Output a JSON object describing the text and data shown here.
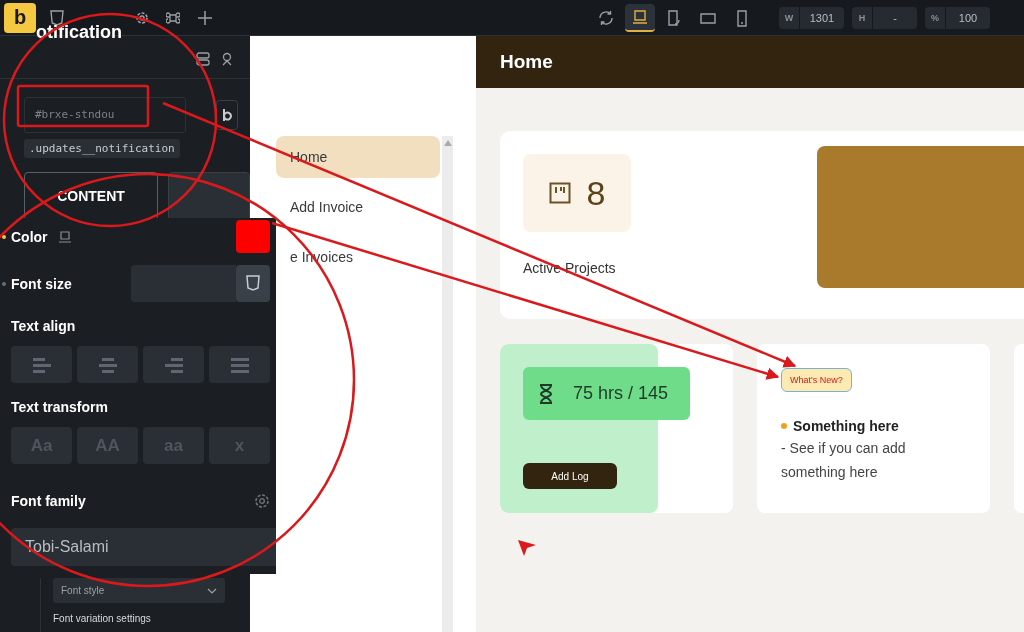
{
  "toolbar": {
    "logo": "b",
    "devices": [
      {
        "kind": "refresh",
        "selected": false
      },
      {
        "kind": "laptop",
        "selected": true
      },
      {
        "kind": "tablet",
        "selected": false
      },
      {
        "kind": "landscape",
        "selected": false
      },
      {
        "kind": "phone",
        "selected": false
      }
    ],
    "fields": [
      {
        "label": "W",
        "value": "1301"
      },
      {
        "label": "H",
        "value": "-"
      },
      {
        "label": "%",
        "value": "100"
      }
    ]
  },
  "panel": {
    "title": "otification",
    "element_id": "#brxe-stndou",
    "css_class": ".updates__notification",
    "tabs": [
      {
        "label": "CONTENT",
        "selected": true
      }
    ],
    "color": {
      "label": "Color",
      "set": true
    },
    "font_size": {
      "label": "Font size",
      "set": false
    },
    "text_align": {
      "label": "Text align",
      "options": [
        {
          "kind": "left"
        },
        {
          "kind": "center"
        },
        {
          "kind": "right"
        },
        {
          "kind": "justify"
        }
      ]
    },
    "text_transform": {
      "label": "Text transform",
      "options": [
        "Aa",
        "AA",
        "aa",
        "x"
      ]
    },
    "font_family": {
      "label": "Font family",
      "value": "Tobi-Salami"
    },
    "font_style": {
      "placeholder": "Font style"
    },
    "font_variation": "Font variation settings"
  },
  "nav": [
    {
      "label": "Home",
      "selected": true
    },
    {
      "label": "Add Invoice",
      "selected": false
    },
    {
      "label": "e Invoices",
      "selected": false
    }
  ],
  "page": {
    "title": "Home",
    "stat": {
      "value": "8",
      "label": "Active Projects"
    },
    "hours": {
      "value": "75 hrs / 145",
      "button": "Add Log"
    },
    "update": {
      "badge": "What's New?",
      "heading": "Something here",
      "text": "- See if you can add something here"
    }
  }
}
